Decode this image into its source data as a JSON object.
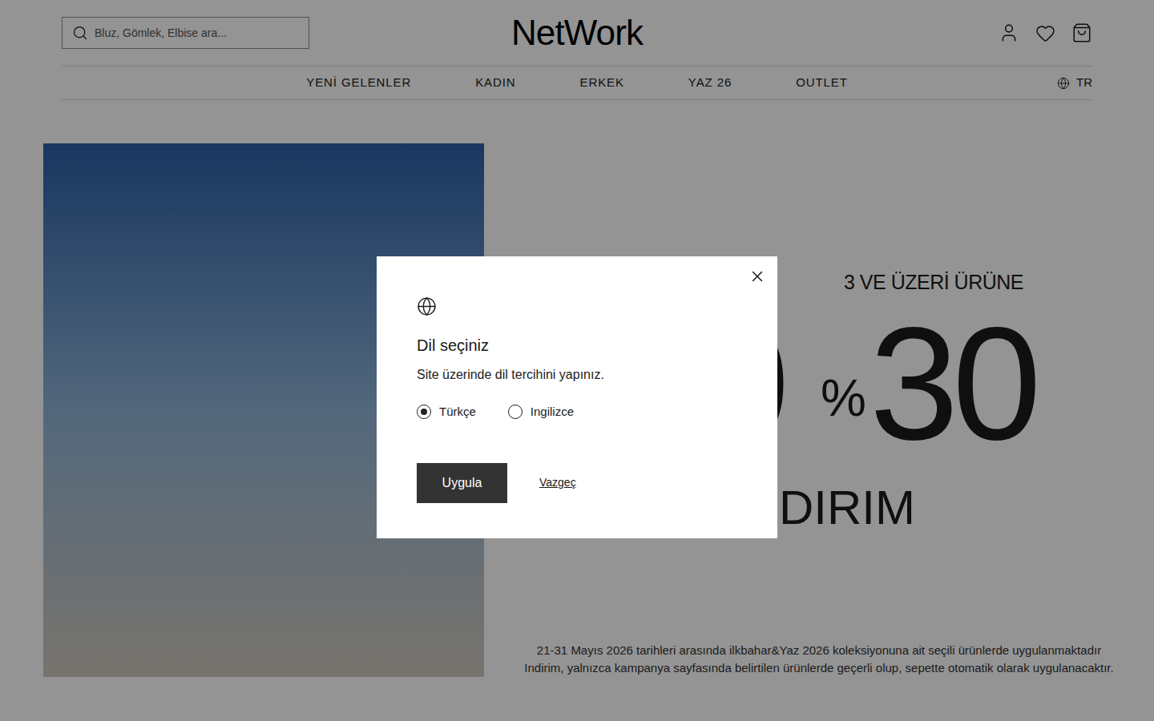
{
  "header": {
    "search": {
      "placeholder": "Bluz, Gömlek, Elbise ara..."
    },
    "logo": "NetWork"
  },
  "nav": {
    "items": [
      {
        "label": "YENİ GELENLER"
      },
      {
        "label": "KADIN"
      },
      {
        "label": "ERKEK"
      },
      {
        "label": "YAZ 26"
      },
      {
        "label": "OUTLET"
      }
    ],
    "language": "TR"
  },
  "promo": {
    "top": "3 VE ÜZERİ ÜRÜNE",
    "hidden_value_fragment": "0",
    "percent": "%",
    "value": "30",
    "word_fragment": "DIRIM",
    "notes": [
      "21-31 Mayıs 2026 tarihleri arasında ilkbahar&Yaz 2026 koleksiyonuna ait seçili ürünlerde uygulanmaktadır",
      "Indirim, yalnızca kampanya sayfasında belirtilen ürünlerde geçerli olup, sepette otomatik olarak uygulanacaktır."
    ]
  },
  "dialog": {
    "title": "Dil seçiniz",
    "description": "Site üzerinde dil tercihini yapınız.",
    "options": [
      {
        "label": "Türkçe",
        "selected": true
      },
      {
        "label": "Ingilizce",
        "selected": false
      }
    ],
    "apply": "Uygula",
    "cancel": "Vazgeç"
  }
}
